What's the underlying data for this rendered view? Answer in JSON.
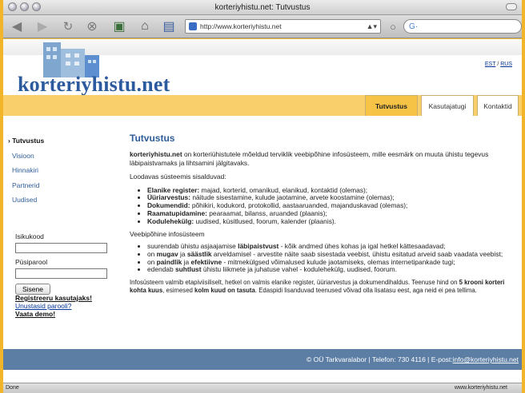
{
  "window": {
    "title": "korteriyhistu.net: Tutvustus"
  },
  "toolbar": {
    "url": "http://www.korteriyhistu.net",
    "search_placeholder": "G·"
  },
  "header": {
    "brand": "korteriyhistu.net",
    "lang_est": "EST",
    "lang_sep": " / ",
    "lang_rus": "RUS"
  },
  "tabs": [
    {
      "label": "Tutvustus",
      "active": true
    },
    {
      "label": "Kasutajatugi",
      "active": false
    },
    {
      "label": "Kontaktid",
      "active": false
    }
  ],
  "sidebar": {
    "items": [
      {
        "label": "› Tutvustus"
      },
      {
        "label": "Visioon"
      },
      {
        "label": "Hinnakiri"
      },
      {
        "label": "Partnerid"
      },
      {
        "label": "Uudised"
      }
    ],
    "login": {
      "user_label": "Isikukood",
      "pass_label": "Püsiparool",
      "submit": "Sisene"
    },
    "links": {
      "register": "Registreeru kasutajaks!",
      "forgot": "Unustasid parooli?",
      "demo": "Vaata demo!"
    }
  },
  "main": {
    "title": "Tutvustus",
    "intro_bold": "korteriyhistu.net",
    "intro_rest": " on korteriühistutele mõeldud terviklik veebipõhine infosüsteem, mille eesmärk on muuta ühistu tegevus läbipaistvamaks ja lihtsamini jälgitavaks.",
    "modules_heading": "Loodavas süsteemis sisalduvad:",
    "modules": [
      {
        "bold": "Elanike register:",
        "text": " majad, korterid, omanikud, elanikud, kontaktid (olemas);"
      },
      {
        "bold": "Üüriarvestus:",
        "text": " näitude sisestamine, kulude jaotamine, arvete koostamine (olemas);"
      },
      {
        "bold": "Dokumendid:",
        "text": " põhikiri, kodukord, protokollid, aastaaruanded, majanduskavad (olemas);"
      },
      {
        "bold": "Raamatupidamine:",
        "text": " pearaamat, bilanss, aruanded (plaanis);"
      },
      {
        "bold": "Kodulehekülg:",
        "text": " uudised, küsitlused, foorum, kalender (plaanis)."
      }
    ],
    "web_heading": "Veebipõhine infosüsteem",
    "benefits": [
      {
        "pre": "suurendab ühistu asjaajamise ",
        "bold": "läbipaistvust",
        "post": " - kõik andmed ühes kohas ja igal hetkel kättesaadavad;"
      },
      {
        "pre": "on ",
        "bold": "mugav",
        "mid": " ja ",
        "bold2": "säästlik",
        "post": " arveldamisel - arvestite näite saab sisestada veebist, ühistu esitatud arveid saab vaadata veebist;"
      },
      {
        "pre": "on ",
        "bold": "paindlik",
        "mid": " ja ",
        "bold2": "efektiivne",
        "post": " - mitmekülgsed võimalused kulude jaotamiseks, olemas internetipankade tugi;"
      },
      {
        "pre": "edendab ",
        "bold": "suhtlust",
        "post": " ühistu liikmete ja juhatuse vahel - kodulehekülg, uudised, foorum."
      }
    ],
    "closing_1": "Infosüsteem valmib etapiviisiliselt, hetkel on valmis elanike register, üüriarvestus ja dokumendihaldus. Teenuse hind on ",
    "closing_b1": "5 krooni korteri kohta kuus",
    "closing_2": ", esimesed ",
    "closing_b2": "kolm kuud on tasuta",
    "closing_3": ". Edaspidi lisanduvad teenused võivad olla lisatasu eest, aga neid ei pea tellima."
  },
  "footer": {
    "text": "© OÜ Tarkvaralabor | Telefon: 730 4116 | E-post: ",
    "email": "info@korteriyhistu.net"
  },
  "status": {
    "left": "Done",
    "right": "www.korteriyhistu.net"
  }
}
